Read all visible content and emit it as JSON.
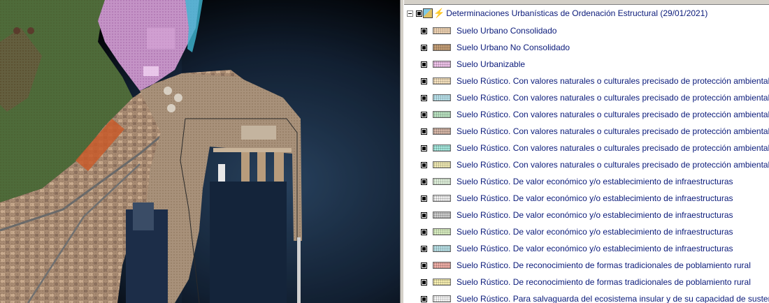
{
  "map": {
    "description_layers": [
      "aerial-photo",
      "zoning-overlay"
    ]
  },
  "legend": {
    "group": {
      "title": "Determinaciones Urbanísticas de Ordenación Estructural (29/01/2021)"
    },
    "items": [
      {
        "label": "Suelo Urbano Consolidado",
        "color": "#f6d9b8"
      },
      {
        "label": "Suelo Urbano No Consolidado",
        "color": "#c9a27a"
      },
      {
        "label": "Suelo Urbanizable",
        "color": "#f3c6ee"
      },
      {
        "label": "Suelo Rústico. Con valores naturales o culturales precisado  de protección ambiental",
        "color": "#fbe6c2"
      },
      {
        "label": "Suelo Rústico. Con valores naturales o culturales precisado  de protección ambiental",
        "color": "#bfe9f3"
      },
      {
        "label": "Suelo Rústico. Con valores naturales o culturales precisado  de protección ambiental",
        "color": "#bfe8c6"
      },
      {
        "label": "Suelo Rústico. Con valores naturales o culturales precisado  de protección ambiental",
        "color": "#d9b9a9"
      },
      {
        "label": "Suelo Rústico. Con valores naturales o culturales precisado  de protección ambiental",
        "color": "#a8ece2"
      },
      {
        "label": "Suelo Rústico. Con valores naturales o culturales precisado  de protección ambiental",
        "color": "#f6efb8"
      },
      {
        "label": "Suelo Rústico. De  valor económico y/o  establecimiento de infraestructuras",
        "color": "#e6f7e2"
      },
      {
        "label": "Suelo Rústico. De  valor económico y/o  establecimiento de infraestructuras",
        "color": "#f4f4f4"
      },
      {
        "label": "Suelo Rústico. De  valor económico y/o  establecimiento de infraestructuras",
        "color": "#cfcfcf"
      },
      {
        "label": "Suelo Rústico. De  valor económico y/o  establecimiento de infraestructuras",
        "color": "#dff5c6"
      },
      {
        "label": "Suelo Rústico. De  valor económico y/o  establecimiento de infraestructuras",
        "color": "#bde6ec"
      },
      {
        "label": "Suelo Rústico. De reconocimiento de formas tradicionales de poblamiento rural",
        "color": "#f2b1a9"
      },
      {
        "label": "Suelo Rústico. De reconocimiento de formas tradicionales de poblamiento rural",
        "color": "#fbf3b4"
      },
      {
        "label": "Suelo Rústico. Para salvaguarda del ecosistema insular y de  su capacidad de sustentación de",
        "color": "#ffffff"
      }
    ]
  }
}
